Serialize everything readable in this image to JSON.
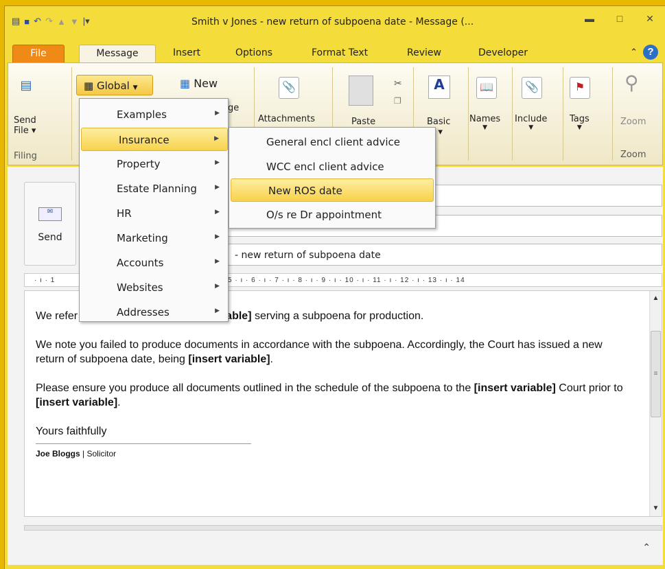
{
  "window": {
    "title": "Smith v Jones - new return of subpoena date  -  Message (..."
  },
  "qat": {
    "icons": [
      "app-icon",
      "save-icon",
      "undo-icon",
      "redo-icon",
      "up-icon",
      "down-icon",
      "customize-icon"
    ]
  },
  "tabs": [
    "File",
    "Message",
    "Insert",
    "Options",
    "Format Text",
    "Review",
    "Developer"
  ],
  "ribbon": {
    "send_file": "Send\nFile",
    "send_file_label": "Send",
    "file_label": "File ▾",
    "filing_group": "Filing",
    "global_button": "Global",
    "new_button": "New",
    "message_partial": "ge",
    "attachments": "Attachments",
    "paste": "Paste",
    "basic": "Basic",
    "basic_text": "xt ▾",
    "names": "Names",
    "include": "Include",
    "tags": "Tags",
    "zoom": "Zoom",
    "zoom_group": "Zoom"
  },
  "global_menu": {
    "items": [
      "Examples",
      "Insurance",
      "Property",
      "Estate Planning",
      "HR",
      "Marketing",
      "Accounts",
      "Websites",
      "Addresses"
    ],
    "highlighted": "Insurance"
  },
  "insurance_menu": {
    "items": [
      "General encl client advice",
      "WCC encl client advice",
      "New ROS date",
      "O/s re Dr appointment"
    ],
    "highlighted": "New ROS date"
  },
  "compose": {
    "send_label": "Send",
    "subject_value": "- new return of subpoena date",
    "ruler": "5 · ı · 6 · ı · 7 · ı · 8 · ı · 9 · ı · 10 · ı · 11 · ı · 12 · ı · 13 · ı · 14",
    "ruler_left": "· ı · 1"
  },
  "letter": {
    "p1_a": "We refer to our letter dated ",
    "p1_b": "[insert variable]",
    "p1_c": " serving a subpoena for production.",
    "p2_a": "We note you failed to produce documents in accordance with the subpoena.  Accordingly, the Court has issued a new return of subpoena date, being ",
    "p2_b": "[insert variable]",
    "p2_c": ".",
    "p3_a": "Please ensure you produce all documents outlined in the schedule of the subpoena to the ",
    "p3_b": "[insert variable]",
    "p3_c": " Court prior to ",
    "p3_d": "[insert variable]",
    "p3_e": ".",
    "closing": "Yours faithfully",
    "sig_name": "Joe Bloggs",
    "sig_sep": " | ",
    "sig_role": "Solicitor"
  }
}
